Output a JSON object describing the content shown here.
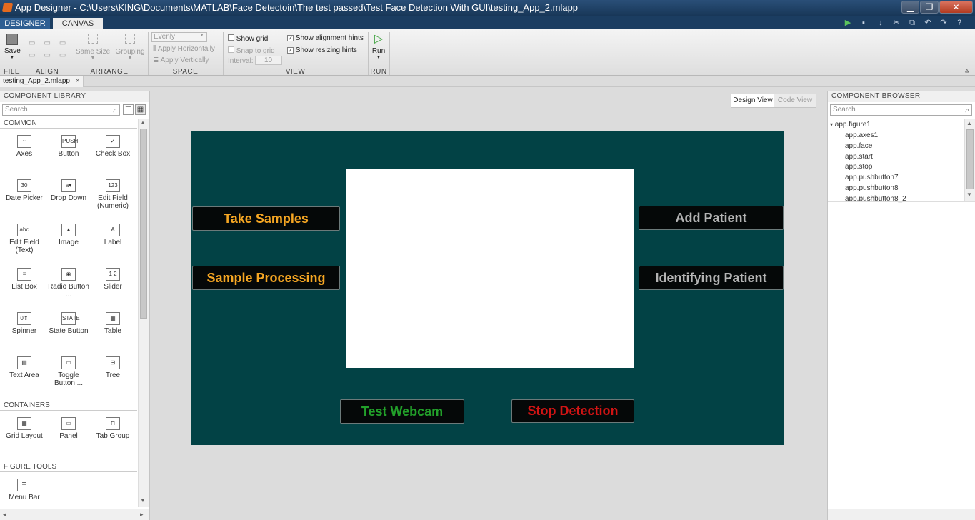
{
  "window": {
    "title": "App Designer - C:\\Users\\KING\\Documents\\MATLAB\\Face Detectoin\\The test passed\\Test Face Detection With GUI\\testing_App_2.mlapp"
  },
  "ribbon_tabs": [
    "DESIGNER",
    "CANVAS"
  ],
  "ribbon": {
    "save": "Save",
    "same_size": "Same Size",
    "grouping": "Grouping",
    "evenly": "Evenly",
    "apply_horizontally": "Apply Horizontally",
    "apply_vertically": "Apply Vertically",
    "show_grid": "Show grid",
    "snap_to_grid": "Snap to grid",
    "interval": "Interval:",
    "interval_value": "10",
    "show_alignment_hints": "Show alignment hints",
    "show_resizing_hints": "Show resizing hints",
    "run": "Run",
    "groups": [
      "FILE",
      "ALIGN",
      "ARRANGE",
      "SPACE",
      "VIEW",
      "RUN"
    ]
  },
  "doc_tab": "testing_App_2.mlapp",
  "library": {
    "header": "COMPONENT LIBRARY",
    "search_placeholder": "Search",
    "sections": {
      "common": "COMMON",
      "containers": "CONTAINERS",
      "figure_tools": "FIGURE TOOLS"
    },
    "common": [
      {
        "label": "Axes",
        "icon": "~"
      },
      {
        "label": "Button",
        "icon": "PUSH"
      },
      {
        "label": "Check Box",
        "icon": "✓"
      },
      {
        "label": "Date Picker",
        "icon": "30"
      },
      {
        "label": "Drop Down",
        "icon": "a▾"
      },
      {
        "label": "Edit Field (Numeric)",
        "icon": "123"
      },
      {
        "label": "Edit Field (Text)",
        "icon": "abc"
      },
      {
        "label": "Image",
        "icon": "▲"
      },
      {
        "label": "Label",
        "icon": "A"
      },
      {
        "label": "List Box",
        "icon": "≡"
      },
      {
        "label": "Radio Button ...",
        "icon": "◉"
      },
      {
        "label": "Slider",
        "icon": "1 2"
      },
      {
        "label": "Spinner",
        "icon": "0⇕"
      },
      {
        "label": "State Button",
        "icon": "STATE"
      },
      {
        "label": "Table",
        "icon": "▦"
      },
      {
        "label": "Text Area",
        "icon": "▤"
      },
      {
        "label": "Toggle Button ...",
        "icon": "▭"
      },
      {
        "label": "Tree",
        "icon": "⊟"
      }
    ],
    "containers": [
      {
        "label": "Grid Layout",
        "icon": "▦"
      },
      {
        "label": "Panel",
        "icon": "▭"
      },
      {
        "label": "Tab Group",
        "icon": "⊓"
      }
    ],
    "figure_tools": [
      {
        "label": "Menu Bar",
        "icon": "☰"
      }
    ]
  },
  "view_toggle": {
    "design": "Design View",
    "code": "Code View"
  },
  "app": {
    "buttons": {
      "take_samples": "Take Samples",
      "sample_processing": "Sample Processing",
      "add_patient": "Add Patient",
      "identifying_patient": "Identifying Patient",
      "test_webcam": "Test Webcam",
      "stop_detection": "Stop Detection"
    },
    "colors": {
      "figure_bg": "#024245",
      "orange": "#f5a623",
      "gray": "#b4b4b4",
      "green": "#22a02a",
      "red": "#d11414"
    }
  },
  "browser": {
    "header": "COMPONENT BROWSER",
    "search_placeholder": "Search",
    "root": "app.figure1",
    "children": [
      "app.axes1",
      "app.face",
      "app.start",
      "app.stop",
      "app.pushbutton7",
      "app.pushbutton8",
      "app.pushbutton8_2"
    ]
  }
}
